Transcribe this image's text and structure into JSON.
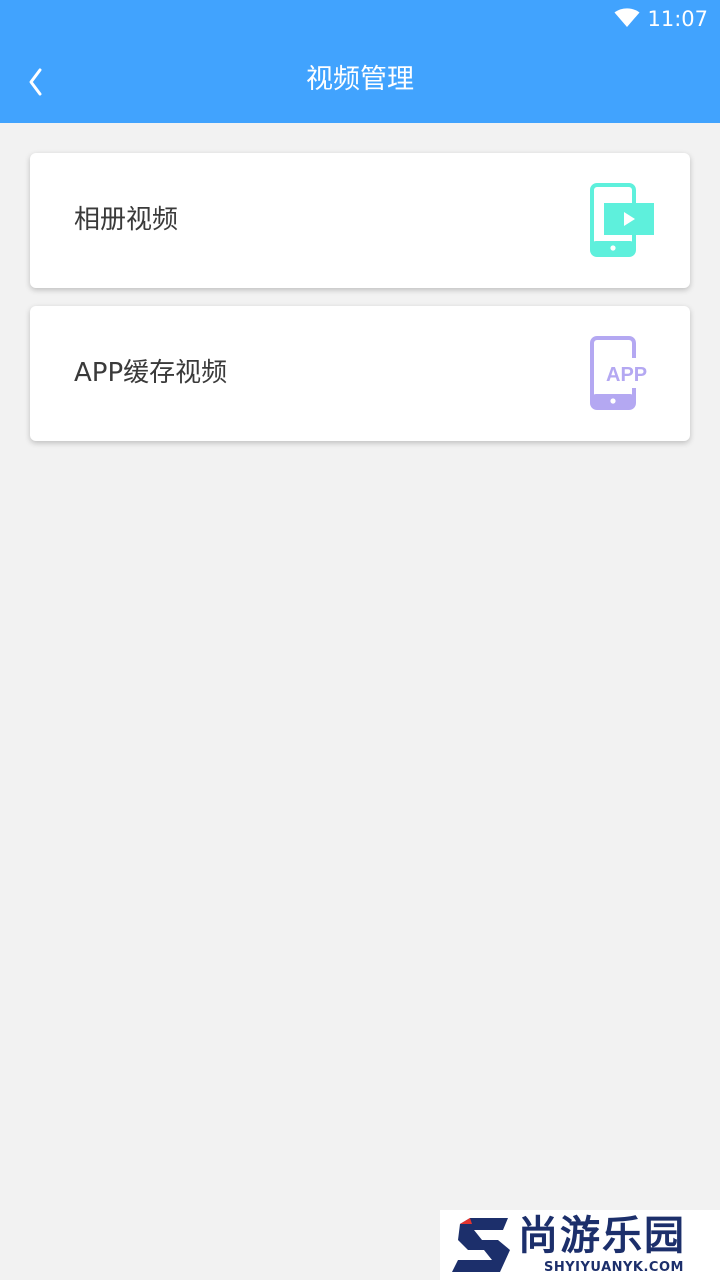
{
  "status_bar": {
    "time": "11:07",
    "icons": [
      "wifi-icon"
    ]
  },
  "app_bar": {
    "title": "视频管理",
    "back_icon": "chevron-left-icon"
  },
  "menu": {
    "items": [
      {
        "label": "相册视频",
        "icon": "phone-video-icon",
        "icon_color": "#5ef0dc"
      },
      {
        "label": "APP缓存视频",
        "icon": "phone-app-icon",
        "icon_color": "#b4a8f2"
      }
    ]
  },
  "watermark": {
    "name_cn": "尚游乐园",
    "site": "SHYIYUANYK.COM"
  },
  "colors": {
    "primary": "#41a3fe",
    "background": "#f2f2f2"
  }
}
